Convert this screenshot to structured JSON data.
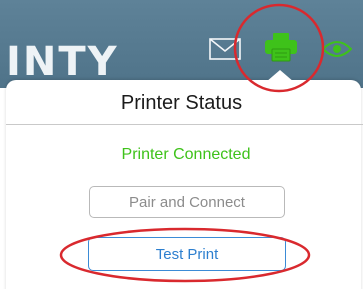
{
  "header": {
    "brand_text": "INTY",
    "icons": [
      "mail-icon",
      "printer-icon",
      "eye-icon"
    ],
    "active_icon": "printer-icon"
  },
  "popover": {
    "title": "Printer Status",
    "status": "Printer Connected",
    "pair_button_label": "Pair and Connect",
    "test_button_label": "Test Print"
  },
  "colors": {
    "header_bg": "#5e8298",
    "printer_icon": "#3ec21a",
    "status_text": "#3ec21a",
    "test_print_border": "#3b8bd6",
    "annotation_circle": "#d9292e"
  }
}
